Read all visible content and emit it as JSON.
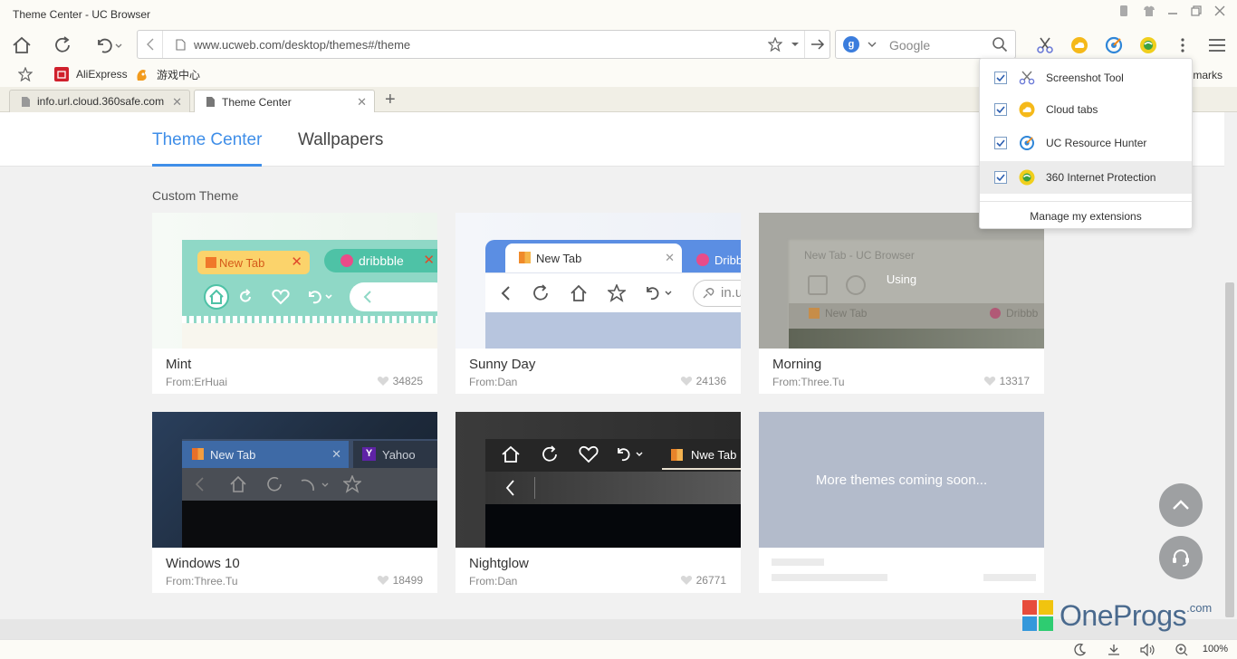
{
  "window": {
    "title": "Theme Center - UC Browser"
  },
  "toolbar": {
    "url": "www.ucweb.com/desktop/themes#/theme",
    "search_placeholder": "Google"
  },
  "bookmarks": {
    "items": [
      {
        "label": "AliExpress",
        "icon": "aliexpress-icon"
      },
      {
        "label": "游戏中心",
        "icon": "game-center-icon"
      }
    ],
    "right_label": "marks"
  },
  "tabs": [
    {
      "label": "info.url.cloud.360safe.com",
      "active": false
    },
    {
      "label": "Theme Center",
      "active": true
    }
  ],
  "page": {
    "nav": [
      {
        "label": "Theme Center",
        "active": true
      },
      {
        "label": "Wallpapers",
        "active": false
      }
    ],
    "section_title": "Custom Theme",
    "themes": [
      {
        "name": "Mint",
        "from": "From:ErHuai",
        "likes": "34825",
        "preview_tabs": [
          "New Tab",
          "dribbble"
        ]
      },
      {
        "name": "Sunny Day",
        "from": "From:Dan",
        "likes": "24136",
        "preview_tabs": [
          "New Tab",
          "Dribb"
        ],
        "preview_url": "in.u"
      },
      {
        "name": "Morning",
        "from": "From:Three.Tu",
        "likes": "13317",
        "status": "Using",
        "preview_title": "New Tab - UC Browser",
        "preview_tabs": [
          "New Tab",
          "Dribbb"
        ]
      },
      {
        "name": "Windows 10",
        "from": "From:Three.Tu",
        "likes": "18499",
        "preview_tabs": [
          "New Tab",
          "Yahoo"
        ]
      },
      {
        "name": "Nightglow",
        "from": "From:Dan",
        "likes": "26771",
        "preview_tabs": [
          "Nwe Tab"
        ]
      }
    ],
    "coming_soon": "More themes coming soon..."
  },
  "extensions_menu": {
    "items": [
      {
        "label": "Screenshot Tool",
        "checked": true,
        "icon": "scissors-icon"
      },
      {
        "label": "Cloud tabs",
        "checked": true,
        "icon": "cloud-icon"
      },
      {
        "label": "UC Resource Hunter",
        "checked": true,
        "icon": "resource-hunter-icon"
      },
      {
        "label": "360 Internet Protection",
        "checked": true,
        "icon": "360-protection-icon",
        "highlighted": true
      }
    ],
    "manage_label": "Manage my extensions"
  },
  "statusbar": {
    "zoom": "100%"
  },
  "watermark": {
    "text": "OneProgs",
    "suffix": ".com"
  },
  "colors": {
    "accent": "#3f8ee8",
    "mint": "#8fd8c6",
    "sunny_blue": "#5b8ee3",
    "soon_bg": "#b3bbcb"
  }
}
